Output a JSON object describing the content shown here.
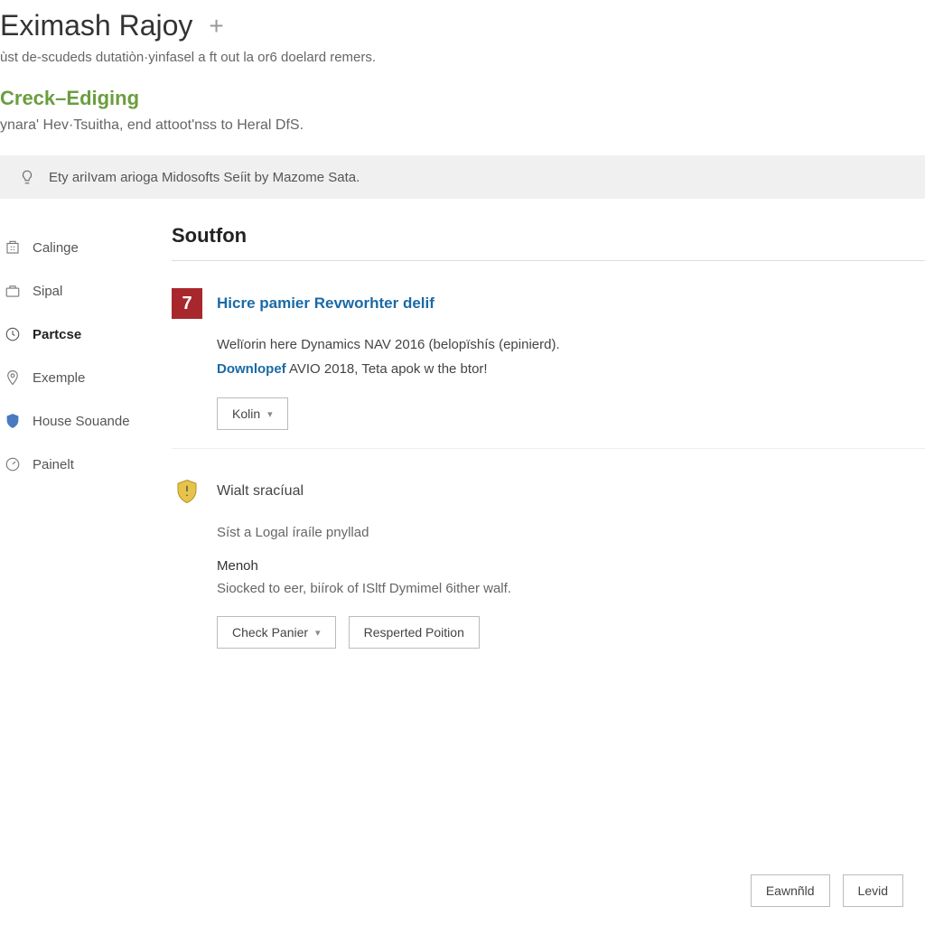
{
  "header": {
    "title": "Eximash Rajoy",
    "subtitle": "ùst de-scudeds dutatiòn·yinfasel a ft out la or6 doelard remers.",
    "section_link": "Creck–Ediging",
    "section_desc": "ynara' Hev·Tsuitha, end attoot'nss to Heral DfS."
  },
  "info_bar": {
    "text": "Ety ariIvam arioga Midosofts Seíit by Mazome Sata."
  },
  "sidebar": {
    "items": [
      {
        "label": "Calinge",
        "active": false
      },
      {
        "label": "Sipal",
        "active": false
      },
      {
        "label": "Partcse",
        "active": true
      },
      {
        "label": "Exemple",
        "active": false
      },
      {
        "label": "House Souande",
        "active": false
      },
      {
        "label": "Painelt",
        "active": false
      }
    ]
  },
  "content": {
    "heading": "Soutfon",
    "items": [
      {
        "badge": "7",
        "title": "Hicre pamier Revworhter delif",
        "desc": "Welïorin here Dynamics NAV 2016 (belopïshís (epinierd).",
        "link_text": "Downlopef",
        "link_suffix": " AVIO 2018, Teta apok w the btor!",
        "buttons": [
          {
            "label": "Kolin",
            "has_chevron": true
          }
        ]
      },
      {
        "badge": "shield",
        "title": "Wialt sracíual",
        "sub": "Síst a Logal íraíle pnyllad",
        "meta_label": "Menoh",
        "meta_desc": "Siocked to eer, biírok of ISltf Dymimel 6ither walf.",
        "buttons": [
          {
            "label": "Check Panier",
            "has_chevron": true
          },
          {
            "label": "Resperted Poition",
            "has_chevron": false
          }
        ]
      }
    ]
  },
  "footer": {
    "buttons": [
      {
        "label": "Eawnñld"
      },
      {
        "label": "Levid"
      }
    ]
  }
}
